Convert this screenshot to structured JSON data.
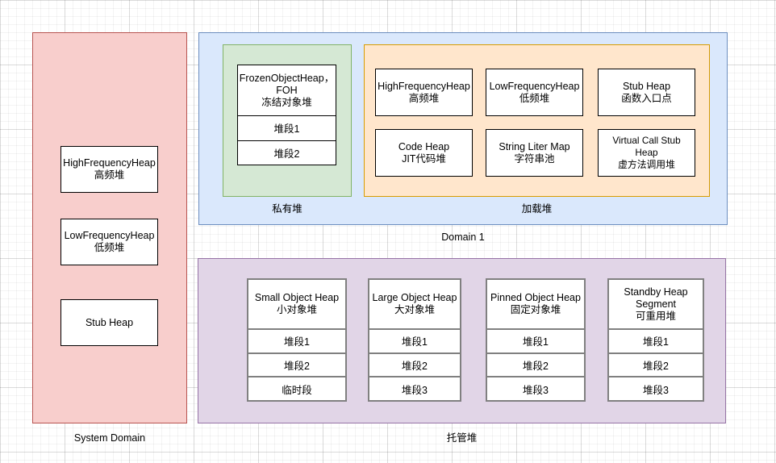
{
  "diagram": {
    "title": "CLR Heap Layout Diagram",
    "colors": {
      "system_domain_fill": "#f8cecc",
      "system_domain_stroke": "#b85450",
      "domain1_fill": "#dae8fc",
      "domain1_stroke": "#6c8ebf",
      "private_heap_fill": "#d5e8d4",
      "private_heap_stroke": "#82b366",
      "loader_heap_fill": "#ffe6cc",
      "loader_heap_stroke": "#d79b00",
      "managed_heap_fill": "#e1d5e7",
      "managed_heap_stroke": "#9673a6",
      "node_fill": "#ffffff",
      "node_stroke": "#000000",
      "node_stroke_gray": "#808080"
    },
    "groups": {
      "system_domain": {
        "caption": "System Domain",
        "nodes": [
          {
            "title_en": "HighFrequencyHeap",
            "title_cn": "高频堆"
          },
          {
            "title_en": "LowFrequencyHeap",
            "title_cn": "低频堆"
          },
          {
            "title_en": "Stub Heap",
            "title_cn": ""
          }
        ]
      },
      "domain1": {
        "caption": "Domain 1",
        "private_heap": {
          "caption": "私有堆",
          "node": {
            "title_en": "FrozenObjectHeap，",
            "title_en2": "FOH",
            "title_cn": "冻结对象堆",
            "segments": [
              "堆段1",
              "堆段2"
            ]
          }
        },
        "loader_heap": {
          "caption": "加载堆",
          "nodes": [
            {
              "title_en": "HighFrequencyHeap",
              "title_cn": "高频堆"
            },
            {
              "title_en": "LowFrequencyHeap",
              "title_cn": "低频堆"
            },
            {
              "title_en": "Stub Heap",
              "title_cn": "函数入口点"
            },
            {
              "title_en": "Code Heap",
              "title_cn": "JIT代码堆"
            },
            {
              "title_en": "String Liter Map",
              "title_cn": "字符串池"
            },
            {
              "title_en": "Virtual Call Stub Heap",
              "title_cn": "虚方法调用堆"
            }
          ]
        }
      },
      "managed_heap": {
        "caption": "托管堆",
        "nodes": [
          {
            "title_en": "Small Object Heap",
            "title_cn": "小对象堆",
            "segments": [
              "堆段1",
              "堆段2",
              "临时段"
            ]
          },
          {
            "title_en": "Large Object Heap",
            "title_cn": "大对象堆",
            "segments": [
              "堆段1",
              "堆段2",
              "堆段3"
            ]
          },
          {
            "title_en": "Pinned Object Heap",
            "title_cn": "固定对象堆",
            "segments": [
              "堆段1",
              "堆段2",
              "堆段3"
            ]
          },
          {
            "title_en": "Standby Heap",
            "title_en2": "Segment",
            "title_cn": "可重用堆",
            "segments": [
              "堆段1",
              "堆段2",
              "堆段3"
            ]
          }
        ]
      }
    }
  }
}
